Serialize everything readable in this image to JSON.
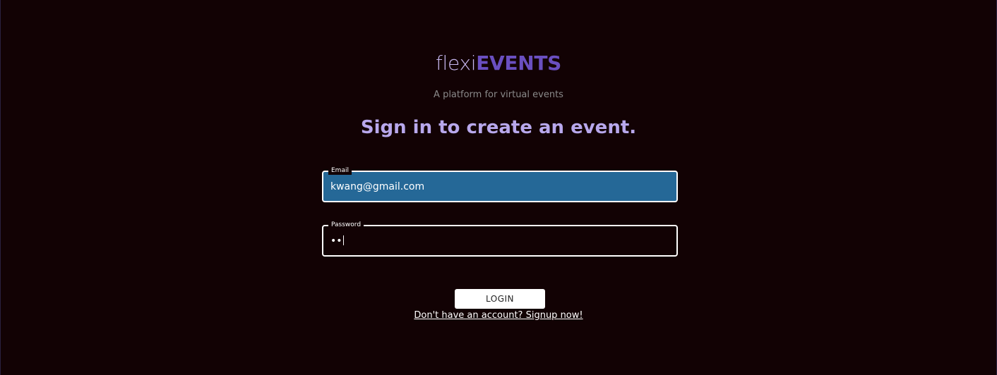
{
  "brand": {
    "logo_light": "flexi",
    "logo_bold": "EVENTS",
    "tagline": "A platform for virtual events"
  },
  "form": {
    "headline": "Sign in to create an event.",
    "email": {
      "label": "Email",
      "value": "kwang@gmail.com"
    },
    "password": {
      "label": "Password",
      "masked_value": "••"
    },
    "login_label": "LOGIN",
    "signup_link": "Don't have an account? Signup now!"
  },
  "colors": {
    "background": "#120204",
    "logo_light": "#c8b8f0",
    "logo_bold": "#6a4fc0",
    "headline": "#b8a8ec",
    "email_field_fill": "#256897"
  }
}
